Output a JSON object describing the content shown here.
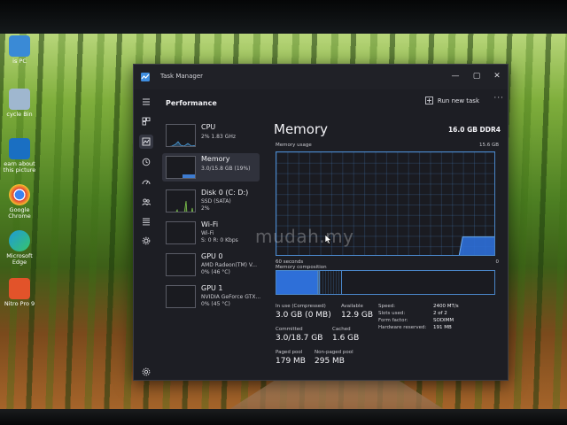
{
  "desktop": {
    "icons": [
      {
        "label_lines": [
          "is PC"
        ],
        "icon": "this-pc-icon",
        "color": "#3a8ad6"
      },
      {
        "label_lines": [
          "cycle Bin"
        ],
        "icon": "recycle-bin-icon",
        "color": "#9fb7cf"
      },
      {
        "label_lines": [
          "earn about",
          "this picture"
        ],
        "icon": "learn-about-picture-icon",
        "color": "#1a6fc2"
      },
      {
        "label_lines": [
          "Google",
          "Chrome"
        ],
        "icon": "chrome-icon",
        "color": "#e34133"
      },
      {
        "label_lines": [
          "Microsoft",
          "Edge"
        ],
        "icon": "edge-icon",
        "color": "#1e9bd8"
      },
      {
        "label_lines": [
          "Nitro Pro 9"
        ],
        "icon": "nitro-pro-icon",
        "color": "#e2532a"
      }
    ],
    "watermark": "mudah.my"
  },
  "window": {
    "title": "Task Manager",
    "controls": {
      "minimize": "—",
      "maximize": "▢",
      "close": "✕"
    }
  },
  "header": {
    "title": "Performance",
    "run_new_task": "Run new task",
    "more": "···"
  },
  "sidebar": {
    "icons": [
      "hamburger-icon",
      "processes-icon",
      "performance-icon",
      "app-history-icon",
      "startup-apps-icon",
      "users-icon",
      "details-icon",
      "services-icon",
      "settings-icon"
    ],
    "active": "performance-icon"
  },
  "devices": [
    {
      "name": "CPU",
      "sub1": "2% 1.83 GHz",
      "sub2": "",
      "color": "#4a9ad8"
    },
    {
      "name": "Memory",
      "sub1": "3.0/15.8 GB (19%)",
      "sub2": "",
      "color": "#3e7cd0"
    },
    {
      "name": "Disk 0 (C: D:)",
      "sub1": "SSD (SATA)",
      "sub2": "2%",
      "color": "#7cc24a"
    },
    {
      "name": "Wi-Fi",
      "sub1": "Wi-Fi",
      "sub2": "S: 0 R: 0 Kbps",
      "color": "#d86aa0"
    },
    {
      "name": "GPU 0",
      "sub1": "AMD Radeon(TM) V...",
      "sub2": "0% (46 °C)",
      "color": "#4a9ad8"
    },
    {
      "name": "GPU 1",
      "sub1": "NVIDIA GeForce GTX...",
      "sub2": "0% (45 °C)",
      "color": "#4a9ad8"
    }
  ],
  "selected_device": "Memory",
  "memory": {
    "title": "Memory",
    "spec": "16.0 GB DDR4",
    "usage_label": "Memory usage",
    "usage_max": "15.6 GB",
    "time_left": "60 seconds",
    "time_right": "0",
    "composition_label": "Memory composition",
    "usage_history": [
      0,
      0,
      0,
      0,
      0,
      0,
      0,
      0,
      0,
      0,
      0,
      0,
      0,
      0,
      0,
      0,
      0,
      0,
      0,
      0,
      0,
      0,
      0,
      0,
      0,
      0,
      0,
      0,
      0,
      0,
      0,
      0,
      0,
      0,
      0,
      0,
      0,
      0,
      0,
      0,
      0,
      0,
      0,
      0,
      0,
      0,
      0,
      0,
      0,
      0,
      19,
      19,
      19,
      19,
      19,
      19,
      19,
      19,
      19,
      19
    ],
    "composition": {
      "in_use_pct": 19,
      "modified_pct": 1,
      "standby_pct": 10,
      "free_pct": 70
    },
    "accent_color": "#2e6fd8",
    "stats": [
      {
        "label": "In use (Compressed)",
        "value": "3.0 GB (0 MB)"
      },
      {
        "label": "Available",
        "value": "12.9 GB"
      },
      {
        "label": "Committed",
        "value": "3.0/18.7 GB"
      },
      {
        "label": "Cached",
        "value": "1.6 GB"
      },
      {
        "label": "Paged pool",
        "value": "179 MB"
      },
      {
        "label": "Non-paged pool",
        "value": "295 MB"
      }
    ],
    "props": [
      {
        "label": "Speed:",
        "value": "2400 MT/s"
      },
      {
        "label": "Slots used:",
        "value": "2 of 2"
      },
      {
        "label": "Form factor:",
        "value": "SODIMM"
      },
      {
        "label": "Hardware reserved:",
        "value": "191 MB"
      }
    ]
  }
}
